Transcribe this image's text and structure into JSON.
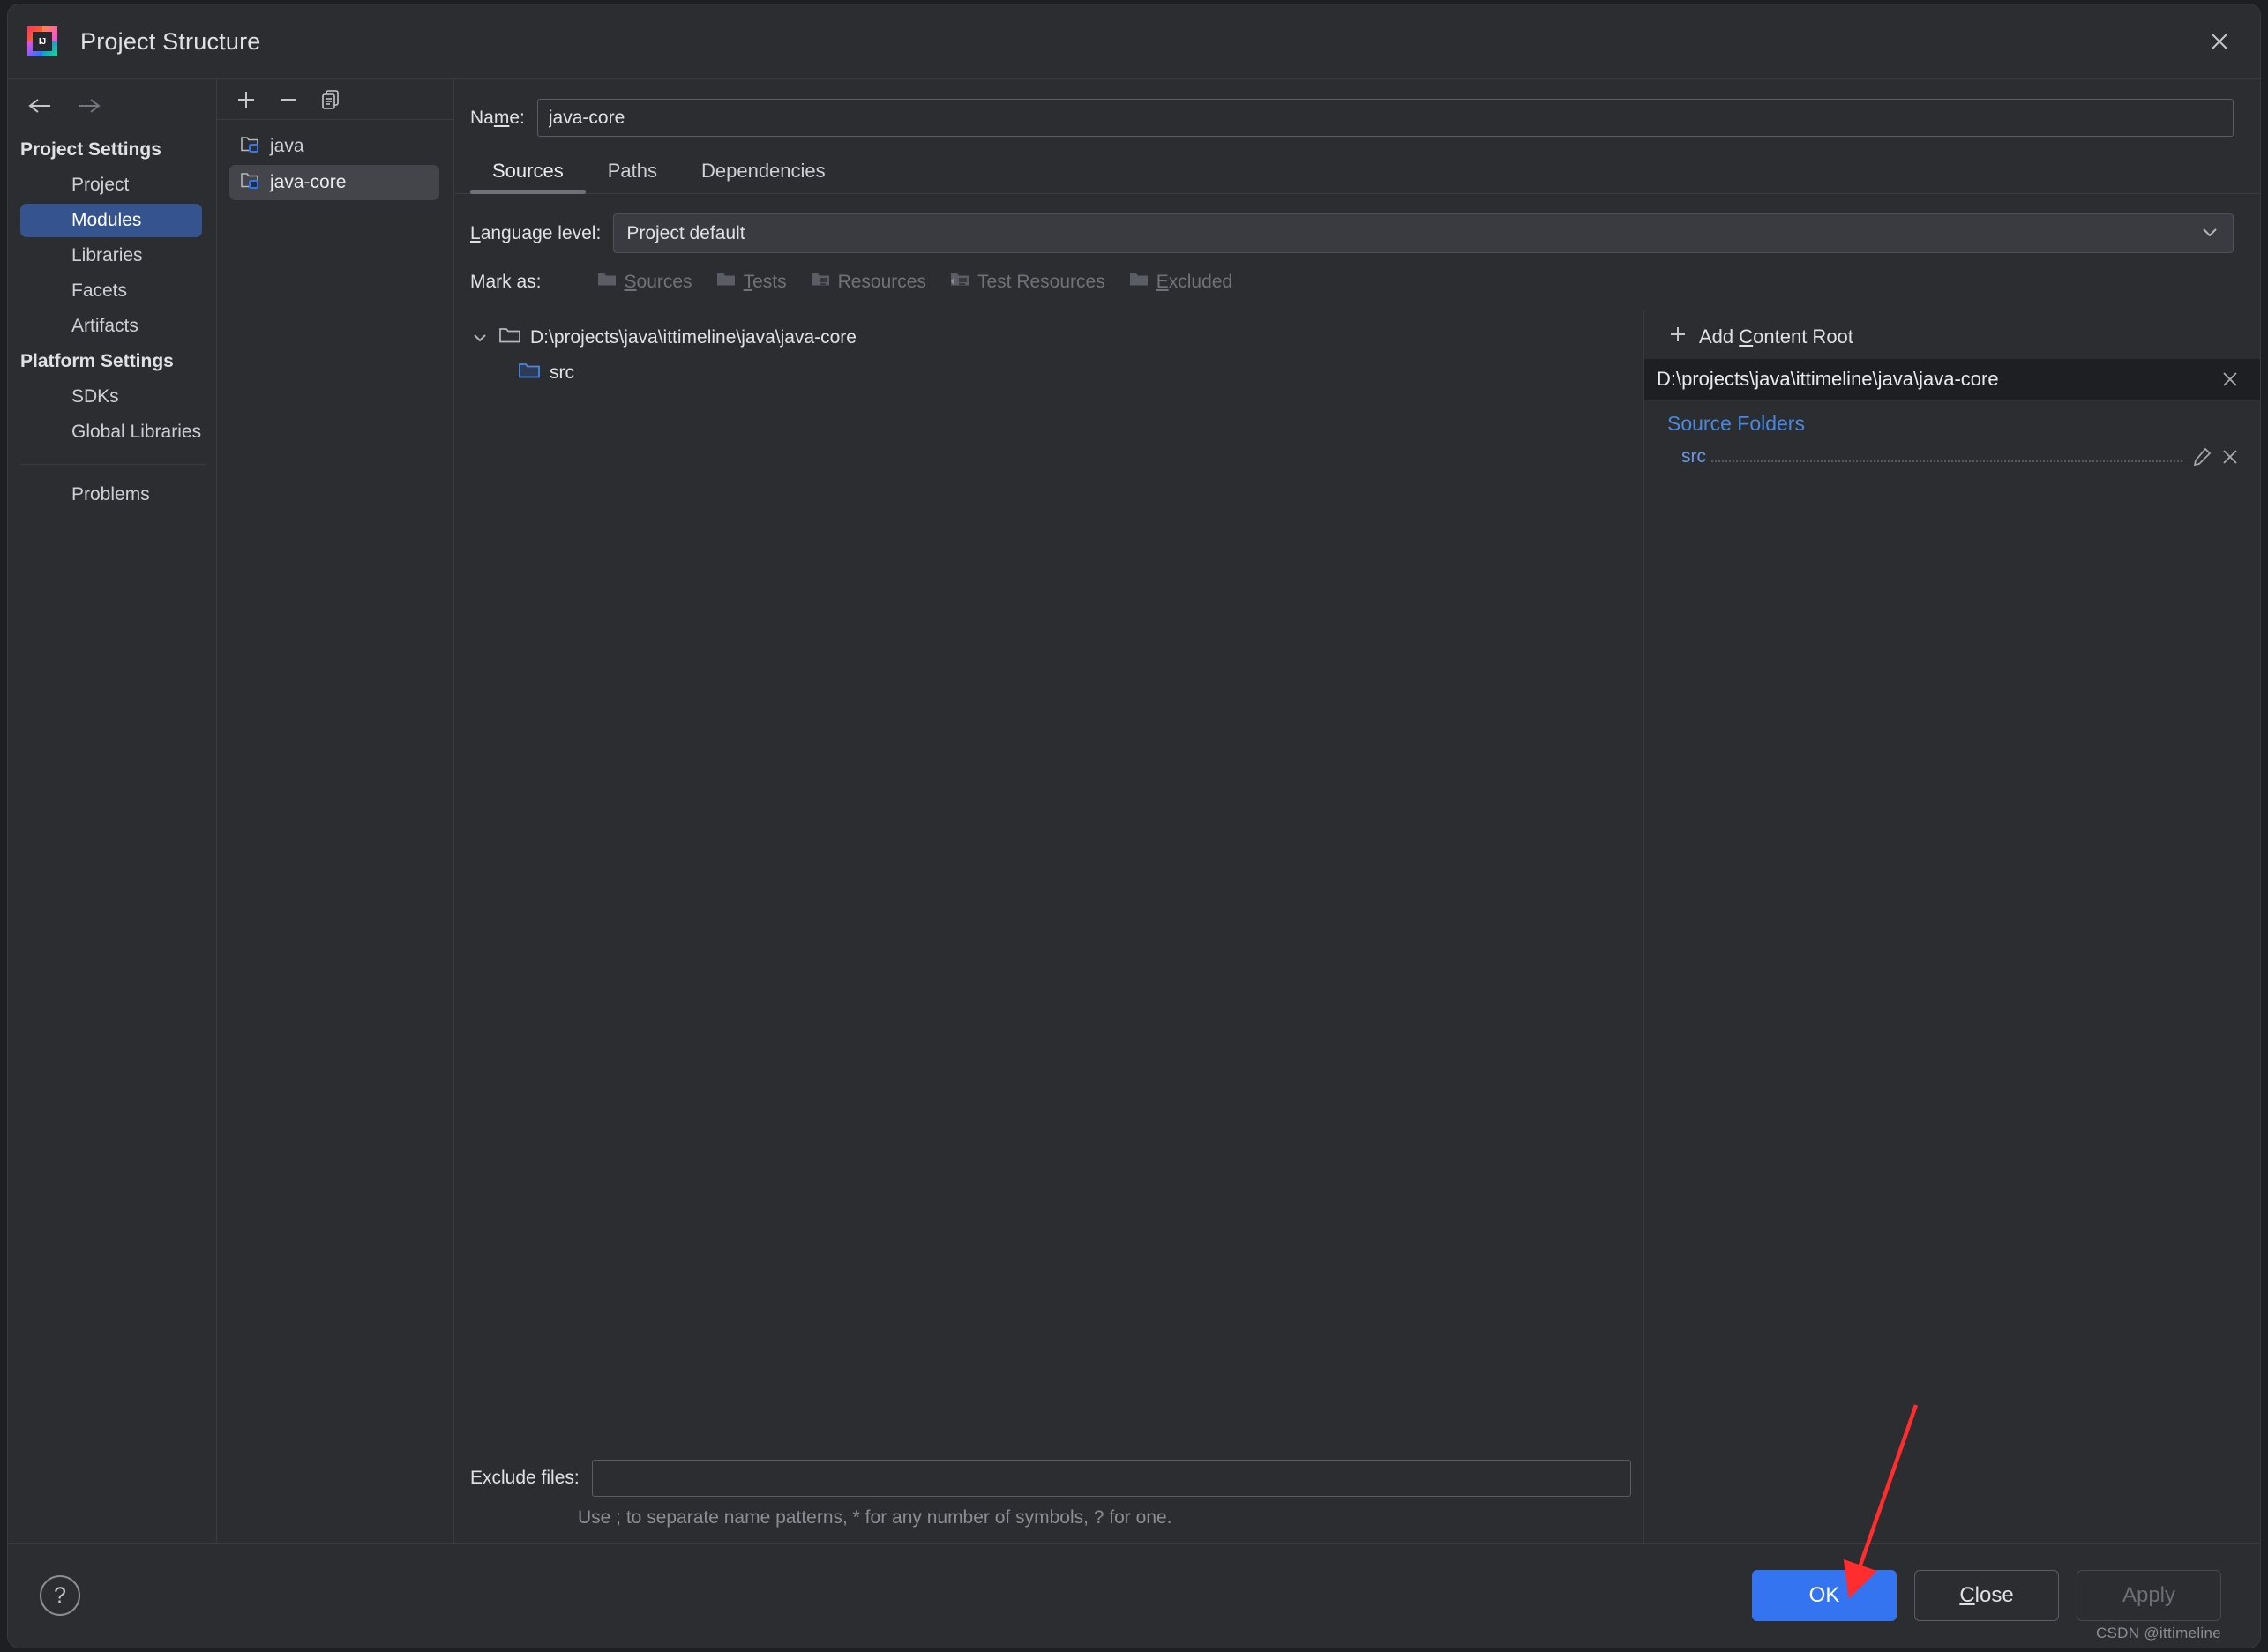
{
  "window": {
    "title": "Project Structure",
    "app_icon": "intellij-idea-icon",
    "close_label": "✕"
  },
  "nav": {
    "back_icon": "arrow-left-icon",
    "forward_icon": "arrow-right-icon"
  },
  "sidebar": {
    "groups": [
      {
        "label": "Project Settings",
        "items": [
          {
            "label": "Project",
            "selected": false
          },
          {
            "label": "Modules",
            "selected": true
          },
          {
            "label": "Libraries",
            "selected": false
          },
          {
            "label": "Facets",
            "selected": false
          },
          {
            "label": "Artifacts",
            "selected": false
          }
        ]
      },
      {
        "label": "Platform Settings",
        "items": [
          {
            "label": "SDKs",
            "selected": false
          },
          {
            "label": "Global Libraries",
            "selected": false
          }
        ]
      }
    ],
    "footer_item": {
      "label": "Problems",
      "selected": false
    }
  },
  "modules_panel": {
    "toolbar": [
      {
        "icon": "plus-icon",
        "tooltip": "Add"
      },
      {
        "icon": "minus-icon",
        "tooltip": "Remove"
      },
      {
        "icon": "copy-icon",
        "tooltip": "Copy"
      }
    ],
    "items": [
      {
        "label": "java",
        "selected": false
      },
      {
        "label": "java-core",
        "selected": true
      }
    ]
  },
  "module_editor": {
    "name_label": "Name:",
    "name_label_mnemonic": "m",
    "name_value": "java-core",
    "tabs": [
      {
        "label": "Sources",
        "active": true
      },
      {
        "label": "Paths",
        "active": false
      },
      {
        "label": "Dependencies",
        "active": false
      }
    ],
    "language_level": {
      "label": "Language level:",
      "label_mnemonic": "L",
      "value": "Project default",
      "chevron": "chevron-down-icon"
    },
    "mark_as": {
      "label": "Mark as:",
      "options": [
        {
          "label": "Sources",
          "mnemonic": "S",
          "icon": "folder-sources-icon",
          "enabled": false
        },
        {
          "label": "Tests",
          "mnemonic": "T",
          "icon": "folder-tests-icon",
          "enabled": false
        },
        {
          "label": "Resources",
          "mnemonic": "",
          "icon": "folder-resources-icon",
          "enabled": false
        },
        {
          "label": "Test Resources",
          "mnemonic": "",
          "icon": "folder-test-resources-icon",
          "enabled": false
        },
        {
          "label": "Excluded",
          "mnemonic": "E",
          "icon": "folder-excluded-icon",
          "enabled": false
        }
      ]
    },
    "content_tree": [
      {
        "label": "D:\\projects\\java\\ittimeline\\java\\java-core",
        "icon": "folder-icon",
        "expanded": true,
        "depth": 0
      },
      {
        "label": "src",
        "icon": "folder-source-icon",
        "expanded": false,
        "depth": 1
      }
    ],
    "exclude": {
      "label": "Exclude files:",
      "value": "",
      "placeholder": "",
      "hint": "Use ; to separate name patterns, * for any number of symbols, ? for one."
    }
  },
  "details_panel": {
    "add_content_root": {
      "label": "Add Content Root",
      "mnemonic": "C",
      "icon": "plus-icon"
    },
    "content_root": {
      "path": "D:\\projects\\java\\ittimeline\\java\\java-core",
      "remove_icon": "close-icon"
    },
    "source_folders_title": "Source Folders",
    "source_folders": [
      {
        "name": "src",
        "edit_icon": "pencil-icon",
        "remove_icon": "close-icon"
      }
    ]
  },
  "footer": {
    "help_label": "?",
    "buttons": [
      {
        "label": "OK",
        "style": "primary",
        "mnemonic": ""
      },
      {
        "label": "Close",
        "style": "normal",
        "mnemonic": "C"
      },
      {
        "label": "Apply",
        "style": "disabled",
        "mnemonic": ""
      }
    ],
    "watermark": "CSDN @ittimeline"
  },
  "annotation": {
    "arrow_color": "#ff2d2d",
    "points_to": "OK"
  },
  "colors": {
    "dialog_bg": "#2b2d30",
    "panel_dark": "#1e1f22",
    "selection_blue": "#35538f",
    "accent_blue": "#3574f0",
    "link_blue": "#4a88df",
    "border": "#393b40",
    "text": "#dfe1e5",
    "text_dim": "#8b8e92"
  }
}
